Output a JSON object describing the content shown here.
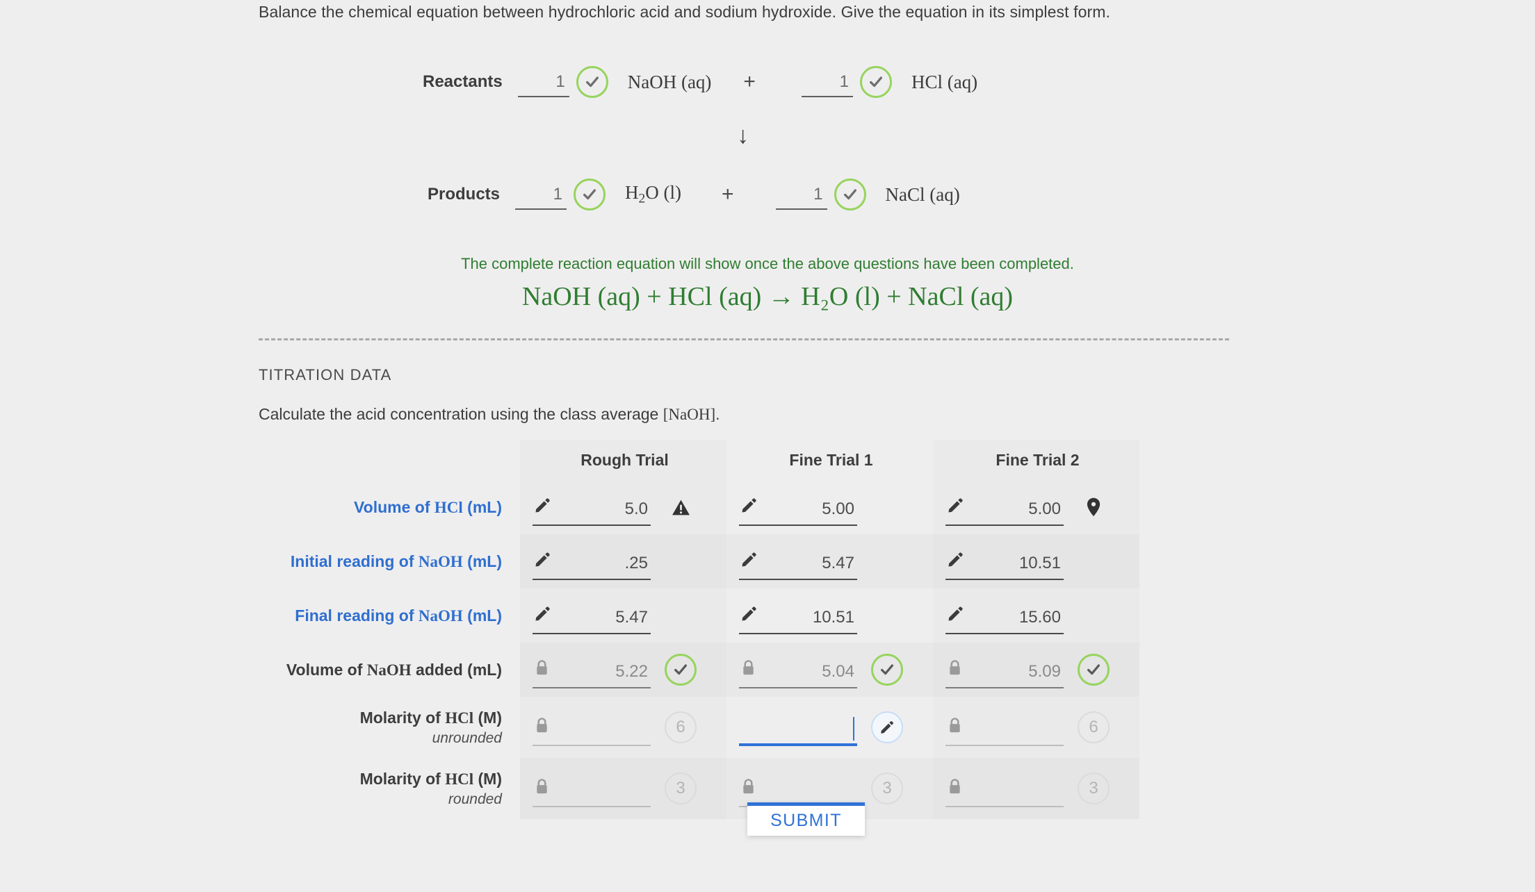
{
  "prompt": "Balance the chemical equation between hydrochloric acid and sodium hydroxide. Give the equation in its simplest form.",
  "equation_builder": {
    "reactants": {
      "label": "Reactants",
      "terms": [
        {
          "coefficient": "1",
          "species": "NaOH (aq)",
          "status": "correct"
        },
        {
          "coefficient": "1",
          "species": "HCl (aq)",
          "status": "correct"
        }
      ],
      "operator": "+"
    },
    "arrow": "↓",
    "products": {
      "label": "Products",
      "terms": [
        {
          "coefficient": "1",
          "species_pre": "H",
          "species_sub": "2",
          "species_post": "O (l)",
          "status": "correct"
        },
        {
          "coefficient": "1",
          "species": "NaCl (aq)",
          "status": "correct"
        }
      ],
      "operator": "+"
    },
    "completion_note": "The complete reaction equation will show once the above questions have been completed.",
    "full_equation": "NaOH (aq) + HCl (aq) → H₂O (l) + NaCl (aq)",
    "green_color": "#2f7d32",
    "check_ring_color": "#97d45f"
  },
  "titration": {
    "section_title": "TITRATION DATA",
    "description": "Calculate the acid concentration using the class average [NaOH].",
    "columns": [
      "Rough Trial",
      "Fine Trial 1",
      "Fine Trial 2"
    ],
    "rows": [
      {
        "label": "Volume of HCl (mL)",
        "label_style": "blue",
        "sublabel": "",
        "cells": [
          {
            "value": "5.0",
            "icon": "pencil-icon",
            "state": "warning",
            "state_icon": "warning-triangle-icon"
          },
          {
            "value": "5.00",
            "icon": "pencil-icon",
            "state": "none"
          },
          {
            "value": "5.00",
            "icon": "pencil-icon",
            "state": "pin",
            "state_icon": "map-pin-icon"
          }
        ]
      },
      {
        "label": "Initial reading of NaOH (mL)",
        "label_style": "blue",
        "sublabel": "",
        "cells": [
          {
            "value": ".25",
            "icon": "pencil-icon",
            "state": "none"
          },
          {
            "value": "5.47",
            "icon": "pencil-icon",
            "state": "none"
          },
          {
            "value": "10.51",
            "icon": "pencil-icon",
            "state": "none"
          }
        ]
      },
      {
        "label": "Final reading of NaOH (mL)",
        "label_style": "blue",
        "sublabel": "",
        "cells": [
          {
            "value": "5.47",
            "icon": "pencil-icon",
            "state": "none"
          },
          {
            "value": "10.51",
            "icon": "pencil-icon",
            "state": "none"
          },
          {
            "value": "15.60",
            "icon": "pencil-icon",
            "state": "none"
          }
        ]
      },
      {
        "label": "Volume of NaOH added (mL)",
        "label_style": "gray",
        "sublabel": "",
        "cells": [
          {
            "value": "5.22",
            "icon": "lock-icon",
            "state": "correct"
          },
          {
            "value": "5.04",
            "icon": "lock-icon",
            "state": "correct"
          },
          {
            "value": "5.09",
            "icon": "lock-icon",
            "state": "correct"
          }
        ]
      },
      {
        "label": "Molarity of HCl (M)",
        "label_style": "gray",
        "sublabel": "unrounded",
        "cells": [
          {
            "value": "",
            "icon": "lock-icon",
            "state": "attempts",
            "attempts": "6"
          },
          {
            "value": "",
            "icon": "none",
            "state": "editing",
            "state_icon": "pencil-icon",
            "active": true
          },
          {
            "value": "",
            "icon": "lock-icon",
            "state": "attempts",
            "attempts": "6"
          }
        ]
      },
      {
        "label": "Molarity of HCl (M)",
        "label_style": "gray",
        "sublabel": "rounded",
        "cells": [
          {
            "value": "",
            "icon": "lock-icon",
            "state": "attempts",
            "attempts": "3"
          },
          {
            "value": "",
            "icon": "lock-icon",
            "state": "attempts",
            "attempts": "3"
          },
          {
            "value": "",
            "icon": "lock-icon",
            "state": "attempts",
            "attempts": "3"
          }
        ]
      }
    ]
  },
  "submit_popup": {
    "label": "SUBMIT",
    "accent_color": "#2f72d8"
  }
}
